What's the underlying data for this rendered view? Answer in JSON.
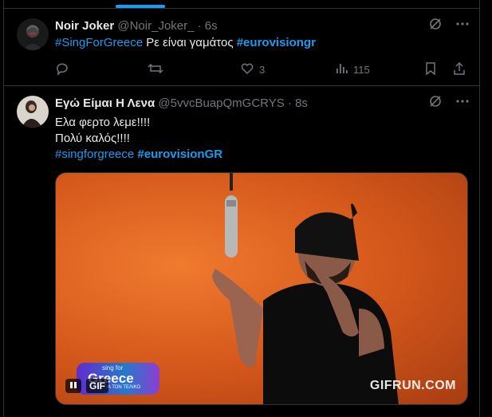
{
  "tweets": [
    {
      "name": "Noir Joker",
      "handle": "@Noir_Joker_",
      "time": "· 6s",
      "text_parts": [
        {
          "text": "#SingForGreece",
          "type": "hashtag"
        },
        {
          "text": " Ρε είναι γαμάτος ",
          "type": "text"
        },
        {
          "text": "#eurovisiongr",
          "type": "hashtag-bold"
        }
      ],
      "actions": {
        "reply_count": "",
        "retweet_count": "",
        "like_count": "3",
        "view_count": "115"
      }
    },
    {
      "name": "Εγώ Είμαι Η Λενα",
      "handle": "@5vvcBuapQmGCRYS",
      "time": "· 8s",
      "lines": [
        "Ελα φερτο λεμε!!!!",
        "Πολύ καλός!!!!"
      ],
      "hashtags": [
        "#singforgreece",
        "#eurovisionGR"
      ],
      "media": {
        "type": "gif",
        "badge": "GIF",
        "watermark": "GIFRUN.COM",
        "logo_text_small": "sing for",
        "logo_text_big": "Greece",
        "logo_text_tiny": "ΓΙΑ ΤΟΝ ΤΕΛΙΚΟ"
      }
    }
  ],
  "colors": {
    "accent": "#1d9bf0",
    "muted": "#71767b",
    "background": "#000000",
    "border": "#2f3336"
  },
  "icons": [
    "grok-icon",
    "more-icon",
    "reply-icon",
    "retweet-icon",
    "like-icon",
    "views-icon",
    "bookmark-icon",
    "share-icon",
    "pause-icon"
  ]
}
